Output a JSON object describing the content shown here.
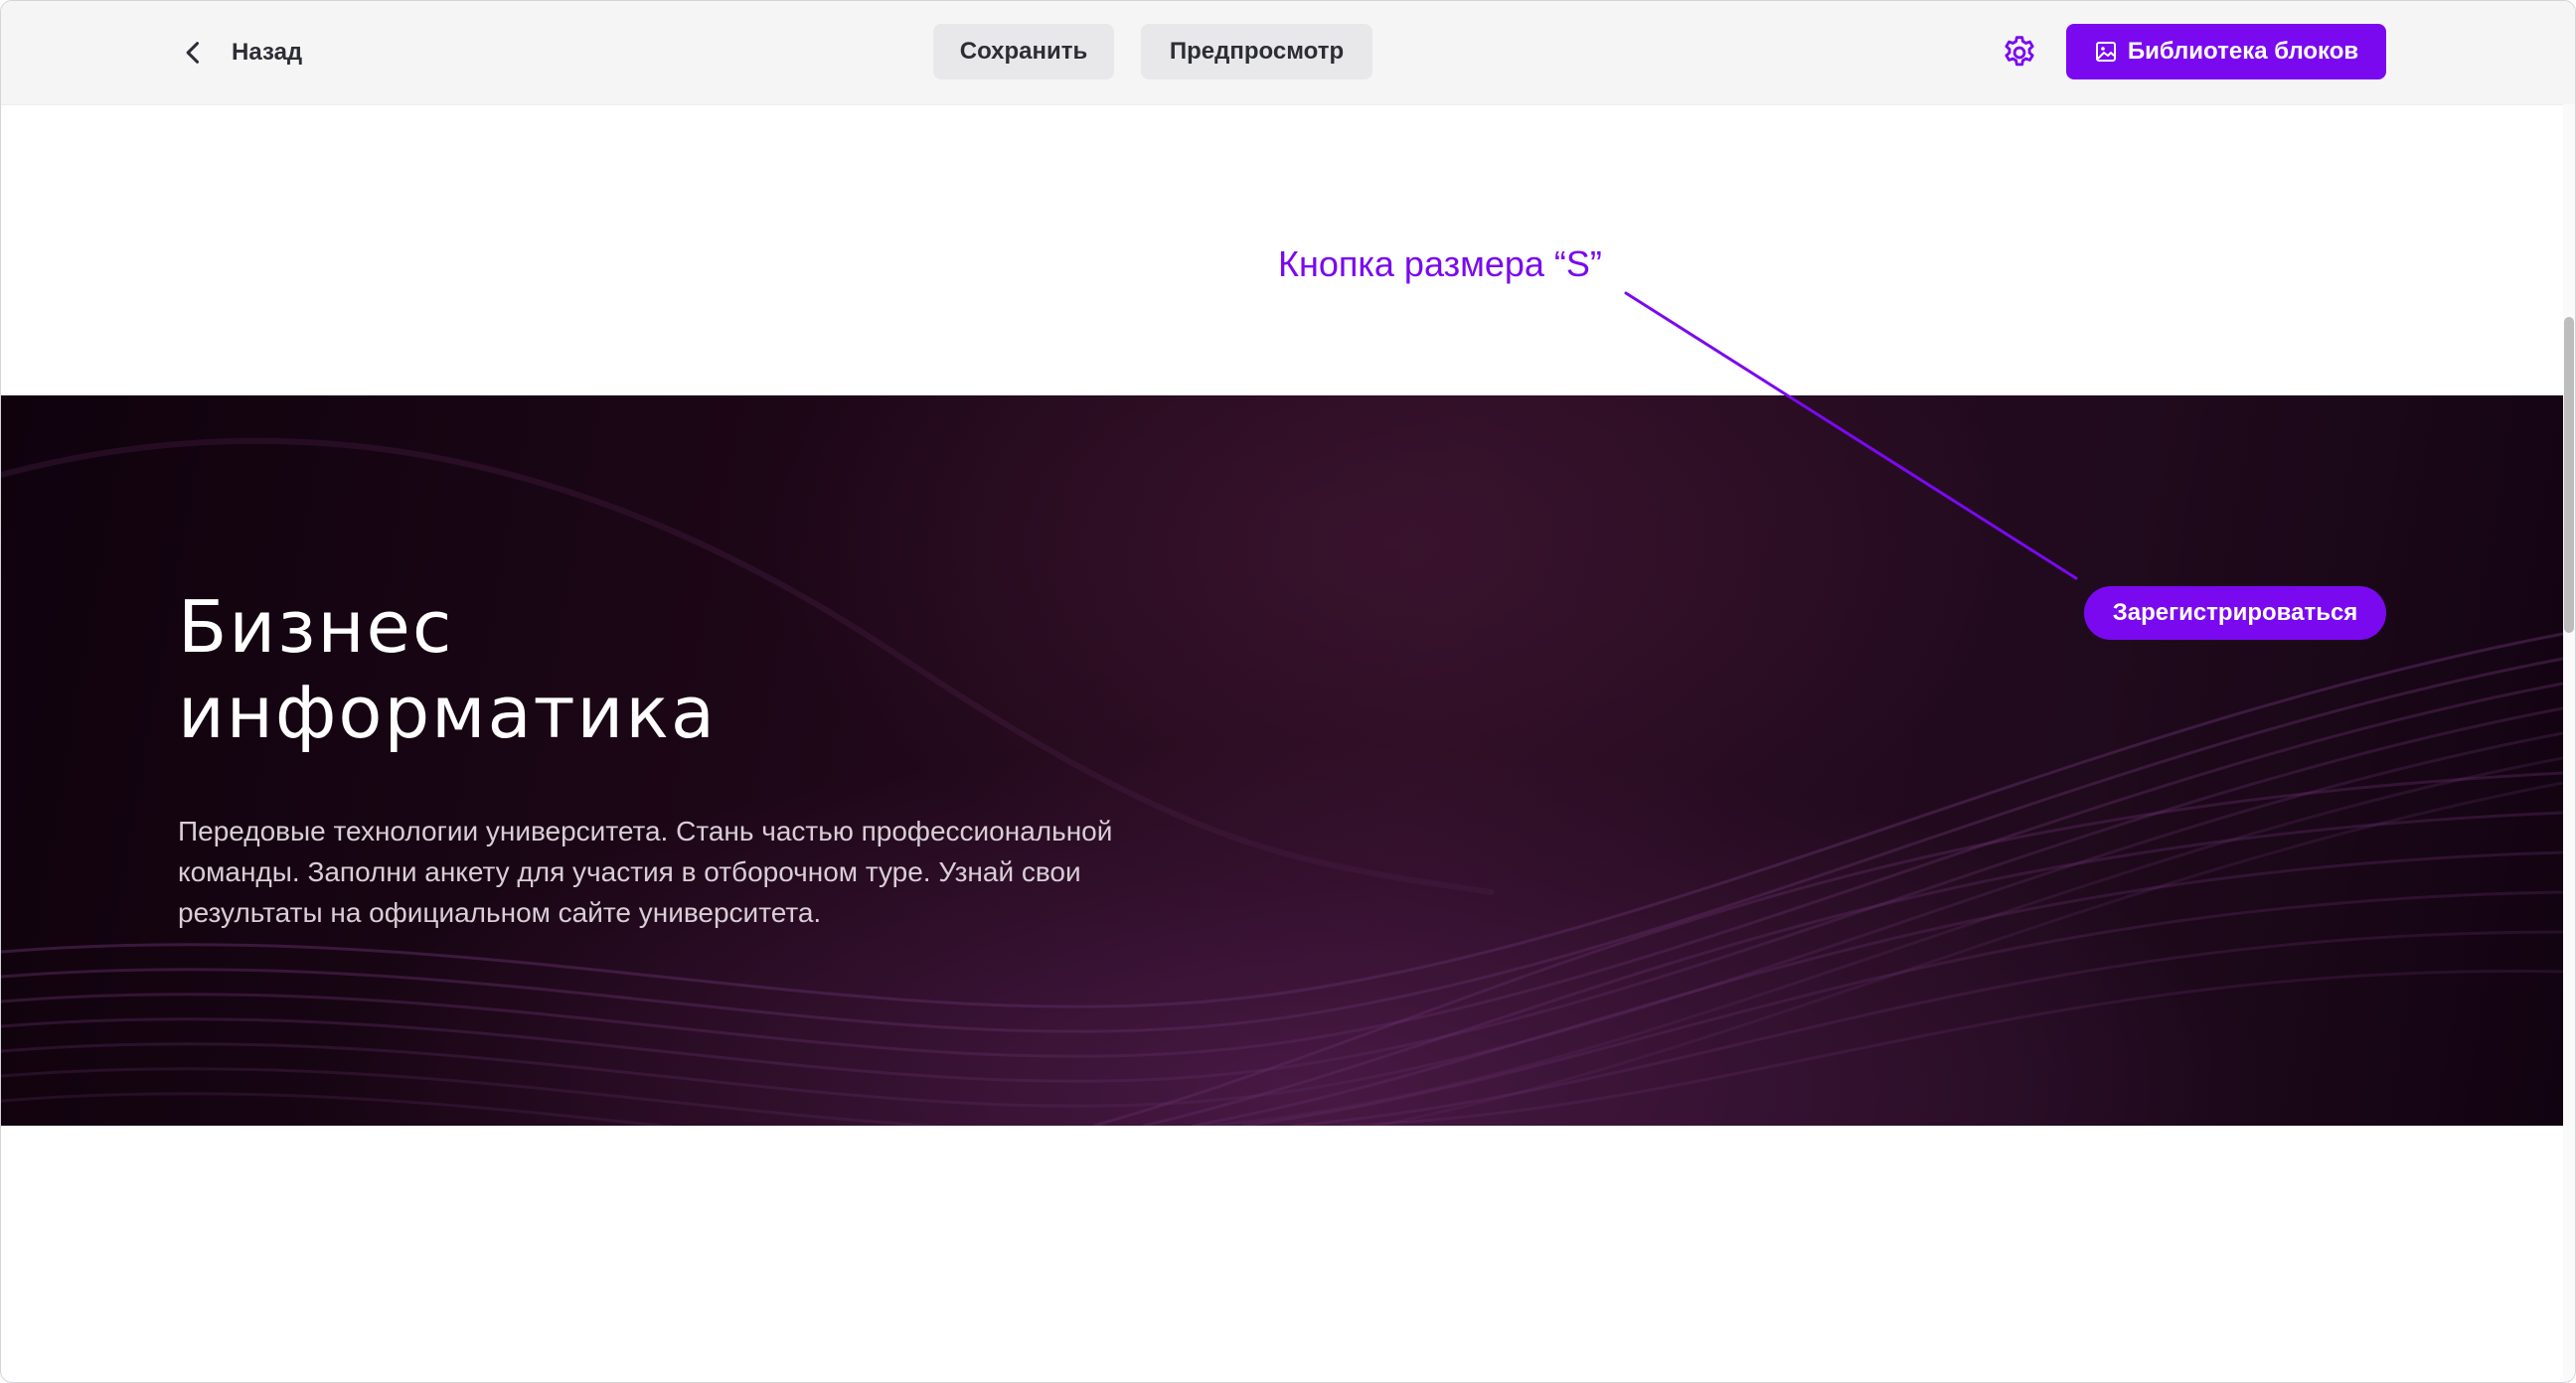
{
  "toolbar": {
    "back_label": "Назад",
    "save_label": "Сохранить",
    "preview_label": "Предпросмотр",
    "library_label": "Библиотека блоков"
  },
  "annotation": {
    "text": "Кнопка размера “S”",
    "color": "#7a09f0"
  },
  "hero": {
    "title_line1": "Бизнес",
    "title_line2": "информатика",
    "description": "Передовые технологии университета. Стань частью профессиональной команды. Заполни анкету для участия в отборочном туре. Узнай свои результаты на официальном сайте университета.",
    "button_label": "Зарегистрироваться"
  },
  "icons": {
    "back": "chevron-left-icon",
    "settings": "gear-icon",
    "library": "image-icon"
  },
  "colors": {
    "accent": "#7a09f0",
    "toolbar_bg": "#f5f5f5",
    "secondary_button_bg": "#e8e8eb",
    "hero_bg": "#1d0717"
  }
}
